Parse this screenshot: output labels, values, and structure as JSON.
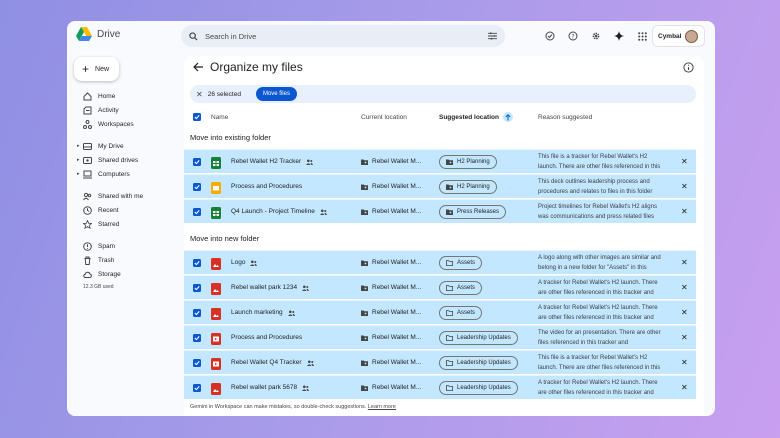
{
  "app": {
    "name": "Drive"
  },
  "search": {
    "placeholder": "Search in Drive"
  },
  "account": {
    "brand": "Cymbal"
  },
  "sidebar": {
    "new_label": "New",
    "items": [
      {
        "label": "Home",
        "icon": "home-icon"
      },
      {
        "label": "Activity",
        "icon": "activity-icon"
      },
      {
        "label": "Workspaces",
        "icon": "workspaces-icon"
      },
      {
        "label": "My Drive",
        "icon": "my-drive-icon"
      },
      {
        "label": "Shared drives",
        "icon": "shared-drives-icon"
      },
      {
        "label": "Computers",
        "icon": "computers-icon"
      },
      {
        "label": "Shared with me",
        "icon": "shared-with-me-icon"
      },
      {
        "label": "Recent",
        "icon": "clock-icon"
      },
      {
        "label": "Starred",
        "icon": "star-icon"
      },
      {
        "label": "Spam",
        "icon": "spam-icon"
      },
      {
        "label": "Trash",
        "icon": "trash-icon"
      },
      {
        "label": "Storage",
        "icon": "cloud-icon"
      }
    ],
    "storage_used": "12.3 GB used"
  },
  "main": {
    "title": "Organize my files",
    "selection": {
      "count_label": "26 selected",
      "move_label": "Move files"
    },
    "headers": {
      "name": "Name",
      "current": "Current location",
      "suggested": "Suggested location",
      "reason": "Reason suggested"
    },
    "section_existing": "Move into existing folder",
    "section_new": "Move into new folder",
    "rows": [
      {
        "name": "Rebel Wallet H2 Tracker",
        "type": "sheets",
        "shared": true,
        "current": "Rebel Wallet M...",
        "suggested": "H2 Planning",
        "reason": "This file is a tracker for Rebel Wallet's H2 launch. There are other files referenced in this"
      },
      {
        "name": "Process and Procedures",
        "type": "slides",
        "shared": false,
        "current": "Rebel Wallet M...",
        "suggested": "H2 Planning",
        "reason": "This deck outlines leadership process and procedures and relates to files in this folder"
      },
      {
        "name": "Q4 Launch - Project Timeline",
        "type": "sheets",
        "shared": true,
        "current": "Rebel Wallet M...",
        "suggested": "Press Releases",
        "reason": "Project timelines for Rebel Wallet's H2 aligns was communications and press related files"
      },
      {
        "name": "Logo",
        "type": "image",
        "shared": true,
        "current": "Rebel Wallet M...",
        "suggested": "Assets",
        "reason": "A logo along with other images are similar and belong in a new folder for \"Assets\" in this"
      },
      {
        "name": "Rebel wallet park 1234",
        "type": "image",
        "shared": true,
        "current": "Rebel Wallet M...",
        "suggested": "Assets",
        "reason": "A tracker for Rebel Wallet's H2 launch. There are other files referenced in this tracker and"
      },
      {
        "name": "Launch marketing",
        "type": "image",
        "shared": true,
        "current": "Rebel Wallet M...",
        "suggested": "Assets",
        "reason": "A tracker for Rebel Wallet's H2 launch. There are other files referenced in this tracker and"
      },
      {
        "name": "Process and Procedures",
        "type": "video",
        "shared": false,
        "current": "Rebel Wallet M...",
        "suggested": "Leadership Updates",
        "reason": "The video for an presentation. There are other files referenced in this tracker and"
      },
      {
        "name": "Rebel Wallet Q4 Tracker",
        "type": "video",
        "shared": true,
        "current": "Rebel Wallet M...",
        "suggested": "Leadership Updates",
        "reason": "This file is a tracker for Rebel Wallet's H2 launch. There are other files referenced in this"
      },
      {
        "name": "Rebel wallet park 5678",
        "type": "image",
        "shared": true,
        "current": "Rebel Wallet M...",
        "suggested": "Leadership Updates",
        "reason": "A tracker for Rebel Wallet's H2 launch. There are other files referenced in this tracker and"
      }
    ],
    "footer_text": "Gemini in Workspace can make mistakes, so double-check suggestions.",
    "footer_link": "Learn more"
  },
  "colors": {
    "accent": "#0b57d0",
    "row_selected": "#c2e7ff",
    "sheets": "#188038",
    "slides": "#f9ab00",
    "media": "#d93025"
  }
}
